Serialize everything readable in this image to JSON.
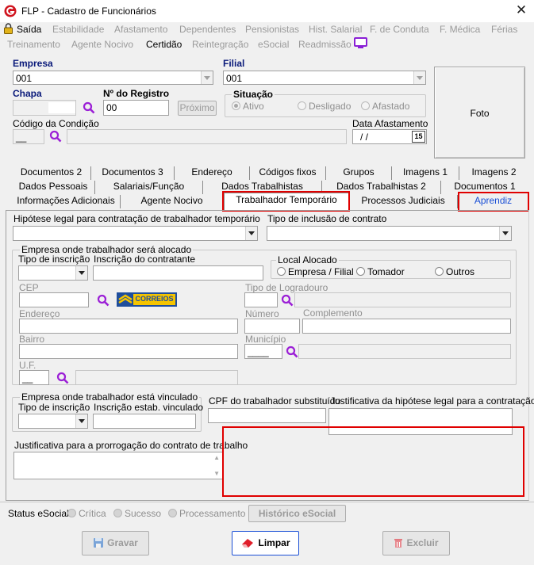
{
  "window": {
    "title": "FLP - Cadastro de Funcionários",
    "close": "✕"
  },
  "menu": {
    "exit": "Saída",
    "row1": [
      "Estabilidade",
      "Afastamento",
      "Dependentes",
      "Pensionistas",
      "Hist. Salarial",
      "F. de Conduta",
      "F. Médica",
      "Férias"
    ],
    "row2": [
      "Treinamento",
      "Agente Nocivo",
      "Certidão",
      "Reintegração",
      "eSocial",
      "Readmissão"
    ]
  },
  "header": {
    "empresa_label": "Empresa",
    "empresa_value": "001",
    "filial_label": "Filial",
    "filial_value": "001",
    "chapa_label": "Chapa",
    "registro_label": "Nº do Registro",
    "registro_value": "00",
    "proximo": "Próximo",
    "situacao_label": "Situação",
    "situacao_ativo": "Ativo",
    "situacao_desligado": "Desligado",
    "situacao_afastado": "Afastado",
    "condicao_label": "Código da Condição",
    "condicao_value": "__",
    "data_afast_label": "Data Afastamento",
    "data_afast_value": "/ /",
    "cal_day": "15",
    "foto": "Foto"
  },
  "tabs": {
    "row1": [
      "Documentos 2",
      "Documentos 3",
      "Endereço",
      "Códigos fixos",
      "Grupos",
      "Imagens 1",
      "Imagens 2"
    ],
    "row2": [
      "Dados Pessoais",
      "Salariais/Função",
      "Dados Trabalhistas",
      "Dados Trabalhistas 2",
      "Documentos 1"
    ],
    "row3": [
      "Informações Adicionais",
      "Agente Nocivo",
      "Trabalhador Temporário",
      "Processos Judiciais",
      "Aprendiz"
    ]
  },
  "temp": {
    "hipotese_label": "Hipótese legal para contratação de trabalhador temporário",
    "tipo_inclusao_label": "Tipo de inclusão de contrato",
    "alocado_group": "Empresa onde trabalhador será alocado",
    "tipo_inscricao_label": "Tipo de inscrição",
    "inscricao_contratante_label": "Inscrição do contratante",
    "local_alocado_group": "Local Alocado",
    "local_empresa": "Empresa / Filial",
    "local_tomador": "Tomador",
    "local_outros": "Outros",
    "cep_label": "CEP",
    "correios": "CORREIOS",
    "tipo_logradouro_label": "Tipo de Logradouro",
    "endereco_label": "Endereço",
    "numero_label": "Número",
    "complemento_label": "Complemento",
    "bairro_label": "Bairro",
    "municipio_label": "Município",
    "municipio_value": "____",
    "uf_label": "U.F.",
    "uf_value": "__",
    "vinculado_group": "Empresa onde trabalhador está vinculado",
    "tipo_inscricao2_label": "Tipo de inscrição",
    "inscricao_estab_label": "Inscrição estab. vinculado",
    "cpf_sub_label": "CPF do trabalhador substituído",
    "justif_hipotese_label": "Justificativa da hipótese legal para a contratação",
    "justif_prorrog_label": "Justificativa para a prorrogação do contrato de trabalho"
  },
  "status": {
    "label": "Status eSocial:",
    "critica": "Crítica",
    "sucesso": "Sucesso",
    "processamento": "Processamento",
    "historico": "Histórico eSocial"
  },
  "buttons": {
    "gravar": "Gravar",
    "limpar": "Limpar",
    "excluir": "Excluir"
  },
  "colors": {
    "highlight": "#e00000",
    "label_blue": "#0a1a7a",
    "app_red": "#d0141e",
    "correios_blue": "#1f4e9c",
    "correios_yellow": "#f5c400",
    "disabled_text": "#9a9a9a"
  }
}
